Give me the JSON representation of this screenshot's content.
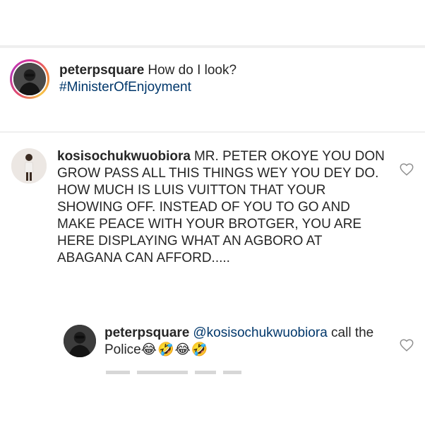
{
  "post": {
    "username": "peterpsquare",
    "caption": "How do I look?",
    "hashtag": "#MinisterOfEnjoyment"
  },
  "comment": {
    "username": "kosisochukwuobiora",
    "text": "MR. PETER OKOYE YOU DON GROW PASS ALL THIS THINGS WEY YOU DEY DO. HOW MUCH IS  LUIS VUITTON THAT YOUR SHOWING OFF. INSTEAD OF YOU TO GO AND MAKE PEACE WITH YOUR BROTGER, YOU ARE HERE DISPLAYING WHAT AN AGBORO AT ABAGANA CAN AFFORD....."
  },
  "reply": {
    "username": "peterpsquare",
    "mention": "@kosisochukwuobiora",
    "text": "call the Police",
    "emojis": "😂🤣😂🤣"
  },
  "icons": {
    "like": "heart-outline-icon"
  },
  "colors": {
    "text": "#262626",
    "link": "#00376b",
    "separator": "#efefef"
  }
}
